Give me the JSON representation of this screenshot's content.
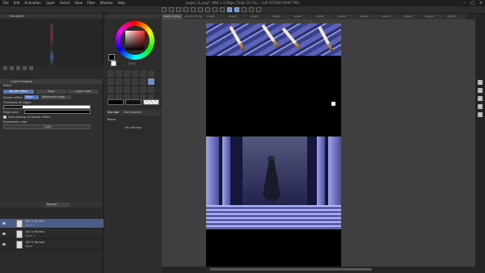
{
  "menu": [
    "File",
    "Edit",
    "Animation",
    "Layer",
    "Select",
    "View",
    "Filter",
    "Window",
    "Help"
  ],
  "title": "page1 (1.png)* (900 x 1740px 72dpi 16.7%) - CLIP STUDIO PAINT PRO",
  "window_controls": [
    "–",
    "□",
    "×"
  ],
  "navigator": {
    "tab": "Navigator"
  },
  "layer_property": {
    "tab": "Layer Property",
    "effect_label": "Effect",
    "modes": [
      "Border effect",
      "Tone",
      "Layer color"
    ],
    "border_effect_label": "Border effect",
    "border_option_a": "Edge",
    "border_option_b": "Watercolor edge",
    "thickness_label": "Thickness of edges",
    "edge_color_label": "Edge color",
    "antialias_label": "Anti-aliasing on border effect",
    "expression_label": "Expression color",
    "expression_value": "Color",
    "slider_fill": 0.22
  },
  "layers": {
    "blend_mode": "Normal",
    "rows": [
      {
        "title": "100 % Normal",
        "sub": "Layer 2"
      },
      {
        "title": "100 % Normal",
        "sub": "Layer 1"
      },
      {
        "title": "100 % Normal",
        "sub": "Paper"
      }
    ]
  },
  "color_wheel": {
    "readout": "0 0 0"
  },
  "sub_tool": {
    "tabs": [
      "Sub tool",
      "Tool property"
    ],
    "label": "Blend",
    "empty": "No settings"
  },
  "doc_tabs": [
    "page1 (1.png)",
    "page2 (2.png)",
    "page3",
    "page4",
    "page5",
    "page6",
    "page7",
    "page8",
    "page9",
    "page10",
    "page11",
    "page12",
    "page13",
    "page14"
  ],
  "icons": [
    "camera-icon",
    "screen-icon",
    "frame-icon",
    "settings-icon",
    "grid-icon"
  ]
}
